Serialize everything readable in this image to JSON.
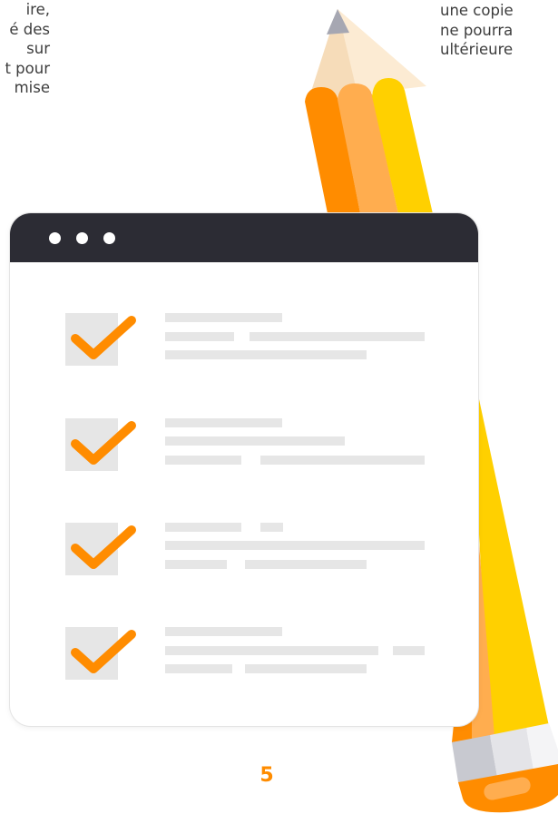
{
  "left_text": {
    "lines": [
      "ire,",
      "é des",
      "sur",
      "t pour",
      "mise"
    ]
  },
  "right_text": {
    "lines": [
      "une copie",
      "ne pourra",
      "ultérieure"
    ]
  },
  "window": {
    "dots": 3,
    "items_checked": [
      true,
      true,
      true,
      true
    ]
  },
  "page_number": "5",
  "colors": {
    "orange": "#ff8c00",
    "light_orange": "#ffad4f",
    "yellow": "#ffd000",
    "window_bar": "#2c2c34",
    "placeholder_gray": "#e6e6e6"
  },
  "icons": {
    "checkmark": "checkmark-icon",
    "pencil": "pencil-illustration"
  }
}
